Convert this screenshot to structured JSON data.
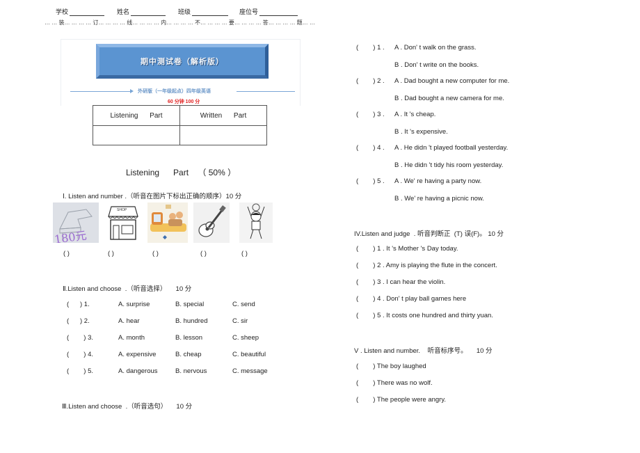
{
  "header": {
    "fields": [
      {
        "label": "学校"
      },
      {
        "label": "姓名"
      },
      {
        "label": "班级"
      },
      {
        "label": "座位号"
      }
    ],
    "seal_line": "… … 装… … … … 订… … … … 线… … … … 内… … … … 不… … … … 要… … … … 答… … … … 题… …"
  },
  "banner": {
    "title": "期中测试卷（解析版）",
    "subtitle": "外研版（一年级起点）四年级英语",
    "duration": "60 分钟  100 分",
    "colors": {
      "banner": "#5b94d1",
      "duration": "#e02020",
      "rule": "#7aa6d6"
    }
  },
  "score_table": {
    "headers": [
      "Listening      Part",
      "Written      Part"
    ],
    "values": [
      "",
      ""
    ]
  },
  "listening_heading": "Listening      Part    （ 50% ）",
  "section1": {
    "heading": "Ⅰ. Listen and number   .（听音在图片下标出正确的顺序）10 分",
    "pictures": [
      {
        "icon": "piano-icon",
        "caption": "180元"
      },
      {
        "icon": "shop-icon",
        "caption": "SHOP"
      },
      {
        "icon": "family-tv-icon",
        "caption": ""
      },
      {
        "icon": "guitar-icon",
        "caption": ""
      },
      {
        "icon": "boy-cheering-icon",
        "caption": ""
      }
    ],
    "answer_blank": "(        )"
  },
  "section2": {
    "heading": "Ⅱ.Listen and choose  .（听音选择）     10 分",
    "items": [
      {
        "num": "(      ) 1.",
        "a": "A.  surprise",
        "b": "B. special",
        "c": "C. send"
      },
      {
        "num": "(      ) 2.",
        "a": "A.  hear",
        "b": "B. hundred",
        "c": "C. sir"
      },
      {
        "num": "(        ) 3.",
        "a": "A.  month",
        "b": "B. lesson",
        "c": "C. sheep"
      },
      {
        "num": "(        ) 4.",
        "a": "A.  expensive",
        "b": "B. cheap",
        "c": "C. beautiful"
      },
      {
        "num": "(        ) 5.",
        "a": "A.  dangerous",
        "b": "B. nervous",
        "c": "C. message"
      }
    ]
  },
  "section3": {
    "heading": "Ⅲ.Listen and choose  .（听音选句）     10 分",
    "items": [
      {
        "num": "(        ) 1 .",
        "a": "A . Don' t walk on the grass.",
        "b": "B . Don' t write on the books."
      },
      {
        "num": "(        ) 2 .",
        "a": "A . Dad bought a new computer for me.",
        "b": "B . Dad bought a new camera for me."
      },
      {
        "num": "(        ) 3 .",
        "a": "A . It 's cheap.",
        "b": "B . It 's expensive."
      },
      {
        "num": "(        ) 4 .",
        "a": "A . He didn 't played football yesterday.",
        "b": "B . He didn 't tidy his room yesterday."
      },
      {
        "num": "(        ) 5 .",
        "a": "A . We' re having a party now.",
        "b": "B . We' re having a picnic now."
      }
    ]
  },
  "section4": {
    "heading": "IV.Listen and judge  . 听音判断正  (T) 误(F)。 10 分",
    "items": [
      "(        ) 1 . It 's Mother 's Day today.",
      "(        ) 2 . Amy is playing the flute in the concert.",
      "(        ) 3 . I can hear the violin.",
      "(        ) 4 . Don' t play ball games here",
      "(        ) 5 . It costs one hundred and thirty yuan."
    ]
  },
  "section5": {
    "heading": "V . Listen and number.    听音标序号。     10 分",
    "items": [
      "(        ) The boy laughed",
      "(        ) There was no wolf.",
      "(        ) The people were angry."
    ]
  }
}
